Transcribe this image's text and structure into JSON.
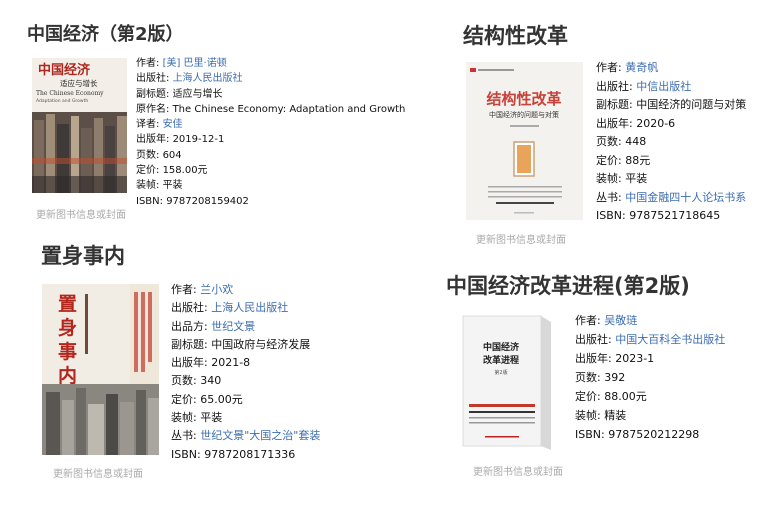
{
  "update_link_label": "更新图书信息或封面",
  "books": [
    {
      "title": "中国经济（第2版）",
      "cover": {
        "title": "中国经济",
        "subtitle": "适应与增长",
        "english": "The Chinese Economy",
        "english_sub": "Adaptation and Growth"
      },
      "fields": [
        {
          "label": "作者: ",
          "value": "[美] 巴里·诺顿",
          "link": true
        },
        {
          "label": "出版社: ",
          "value": "上海人民出版社",
          "link": true
        },
        {
          "label": "副标题: ",
          "value": "适应与增长",
          "link": false
        },
        {
          "label": "原作名: ",
          "value": "The Chinese Economy: Adaptation and Growth",
          "link": false
        },
        {
          "label": "译者: ",
          "value": "安佳",
          "link": true
        },
        {
          "label": "出版年: ",
          "value": "2019-12-1",
          "link": false
        },
        {
          "label": "页数: ",
          "value": "604",
          "link": false
        },
        {
          "label": "定价: ",
          "value": "158.00元",
          "link": false
        },
        {
          "label": "装帧: ",
          "value": "平装",
          "link": false
        },
        {
          "label": "ISBN: ",
          "value": "9787208159402",
          "link": false
        }
      ]
    },
    {
      "title": "结构性改革",
      "cover": {
        "title": "结构性改革",
        "subtitle": "中国经济的问题与对策"
      },
      "fields": [
        {
          "label": "作者: ",
          "value": "黄奇帆",
          "link": true
        },
        {
          "label": "出版社: ",
          "value": "中信出版社",
          "link": true
        },
        {
          "label": "副标题: ",
          "value": "中国经济的问题与对策",
          "link": false
        },
        {
          "label": "出版年: ",
          "value": "2020-6",
          "link": false
        },
        {
          "label": "页数: ",
          "value": "448",
          "link": false
        },
        {
          "label": "定价: ",
          "value": "88元",
          "link": false
        },
        {
          "label": "装帧: ",
          "value": "平装",
          "link": false
        },
        {
          "label": "丛书: ",
          "value": "中国金融四十人论坛书系",
          "link": true
        },
        {
          "label": "ISBN: ",
          "value": "9787521718645",
          "link": false
        }
      ]
    },
    {
      "title": "置身事内",
      "cover": {
        "title": "置身事内",
        "subtitle": "中国政府与经济发展"
      },
      "fields": [
        {
          "label": "作者: ",
          "value": "兰小欢",
          "link": true
        },
        {
          "label": "出版社: ",
          "value": "上海人民出版社",
          "link": true
        },
        {
          "label": "出品方: ",
          "value": "世纪文景",
          "link": true
        },
        {
          "label": "副标题: ",
          "value": "中国政府与经济发展",
          "link": false
        },
        {
          "label": "出版年: ",
          "value": "2021-8",
          "link": false
        },
        {
          "label": "页数: ",
          "value": "340",
          "link": false
        },
        {
          "label": "定价: ",
          "value": "65.00元",
          "link": false
        },
        {
          "label": "装帧: ",
          "value": "平装",
          "link": false
        },
        {
          "label": "丛书: ",
          "value": "世纪文景\"大国之治\"套装",
          "link": true
        },
        {
          "label": "ISBN: ",
          "value": "9787208171336",
          "link": false
        }
      ]
    },
    {
      "title": "中国经济改革进程(第2版)",
      "cover": {
        "title": "中国经济改革进程",
        "subtitle": "第2版"
      },
      "fields": [
        {
          "label": "作者: ",
          "value": "吴敬琏",
          "link": true
        },
        {
          "label": "出版社: ",
          "value": "中国大百科全书出版社",
          "link": true
        },
        {
          "label": "出版年: ",
          "value": "2023-1",
          "link": false
        },
        {
          "label": "页数: ",
          "value": "392",
          "link": false
        },
        {
          "label": "定价: ",
          "value": "88.00元",
          "link": false
        },
        {
          "label": "装帧: ",
          "value": "精装",
          "link": false
        },
        {
          "label": "ISBN: ",
          "value": "9787520212298",
          "link": false
        }
      ]
    }
  ]
}
